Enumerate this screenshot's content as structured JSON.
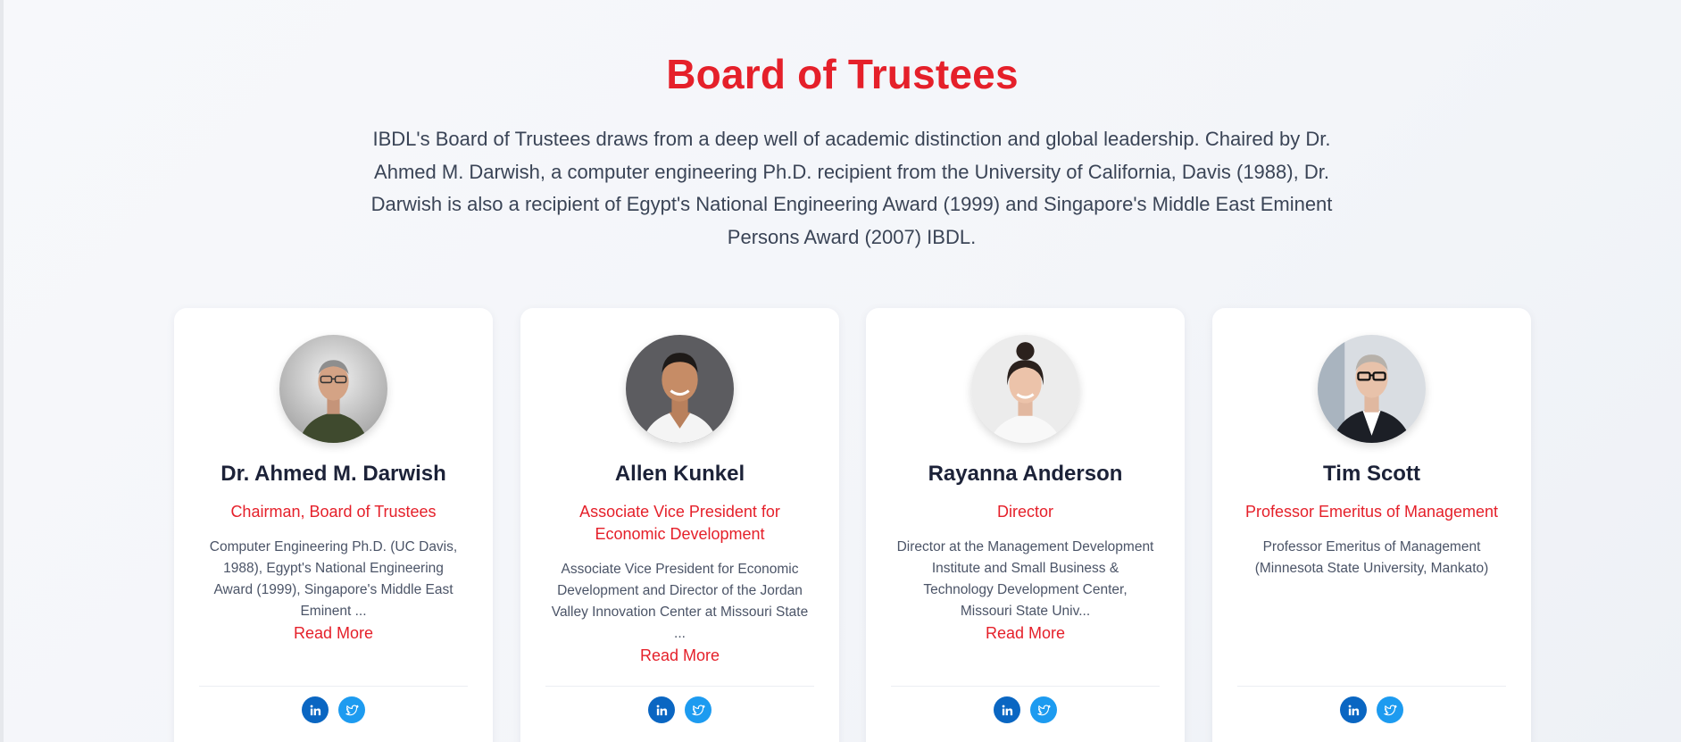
{
  "section": {
    "title": "Board of Trustees",
    "intro": "IBDL's Board of Trustees draws from a deep well of academic distinction and global leadership. Chaired by Dr. Ahmed M. Darwish, a computer engineering Ph.D. recipient from the University of California, Davis (1988), Dr. Darwish is also a recipient of Egypt's National Engineering Award (1999) and Singapore's Middle East Eminent Persons Award (2007) IBDL."
  },
  "colors": {
    "accent": "#e5202a",
    "linkedin": "#0a66c2",
    "twitter": "#1d9bf0"
  },
  "trustees": [
    {
      "name": "Dr. Ahmed M. Darwish",
      "role": "Chairman, Board of Trustees",
      "description": "Computer Engineering Ph.D. (UC Davis, 1988), Egypt's National Engineering Award (1999), Singapore's Middle East Eminent ...",
      "read_more": "Read More",
      "social_icons": [
        "linkedin-icon",
        "twitter-icon"
      ]
    },
    {
      "name": "Allen Kunkel",
      "role": "Associate Vice President for Economic Development",
      "description": "Associate Vice President for Economic Development and Director of the Jordan Valley Innovation Center at Missouri State ...",
      "read_more": "Read More",
      "social_icons": [
        "linkedin-icon",
        "twitter-icon"
      ]
    },
    {
      "name": "Rayanna Anderson",
      "role": "Director",
      "description": "Director at the Management Development Institute and Small Business & Technology Development Center, Missouri State Univ...",
      "read_more": "Read More",
      "social_icons": [
        "linkedin-icon",
        "twitter-icon"
      ]
    },
    {
      "name": "Tim Scott",
      "role": "Professor Emeritus of Management",
      "description": "Professor Emeritus of Management (Minnesota State University, Mankato)",
      "social_icons": [
        "linkedin-icon",
        "twitter-icon"
      ]
    }
  ]
}
